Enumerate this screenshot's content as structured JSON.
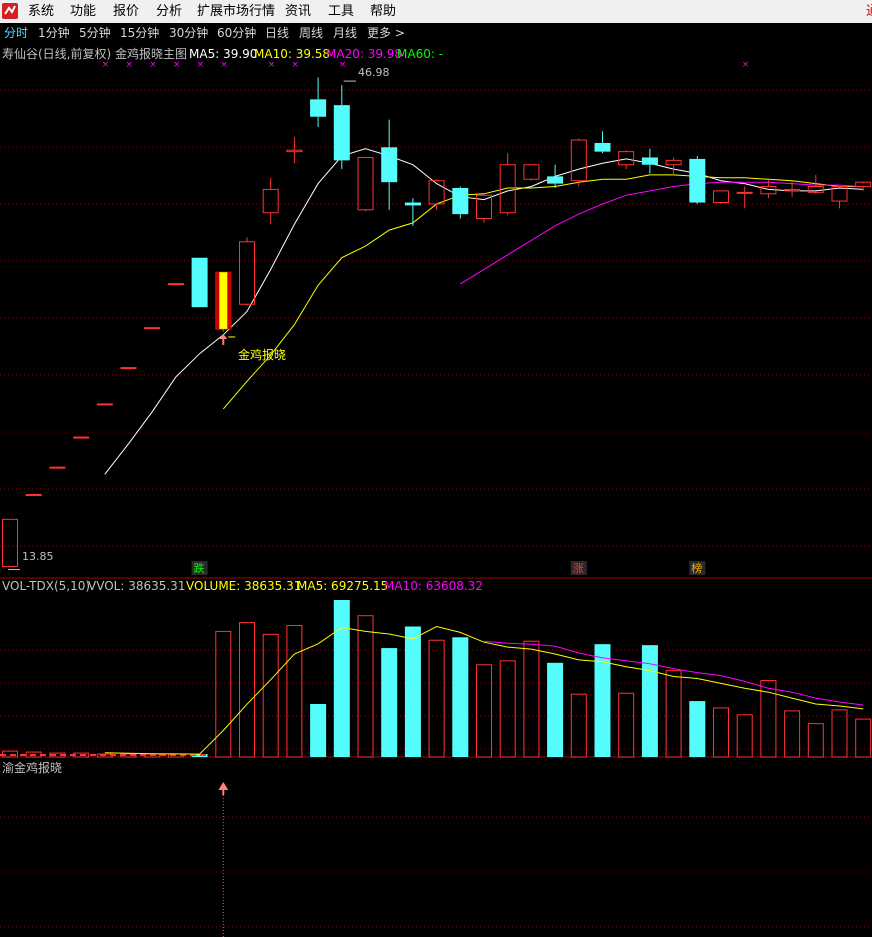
{
  "menu": [
    "系统",
    "功能",
    "报价",
    "分析",
    "扩展市场行情",
    "资讯",
    "工具",
    "帮助"
  ],
  "menu_edge": "通",
  "periods": [
    "分时",
    "1分钟",
    "5分钟",
    "15分钟",
    "30分钟",
    "60分钟",
    "日线",
    "周线",
    "月线",
    "更多 >"
  ],
  "active_period": "分时",
  "colors": {
    "up": "#ff3232",
    "down": "#54fcfc",
    "ma5": "#ffffff",
    "ma10": "#ffff00",
    "ma20": "#ff00ff",
    "ma60": "#00ff00",
    "grid": "#8b0000",
    "axis": "#a00000",
    "text": "#c0c0c0",
    "marker": "#ff8080"
  },
  "main_panel": {
    "title": "寿仙谷(日线,前复权) 金鸡报晓主图",
    "ma5_label": "MA5: 39.90",
    "ma10_label": "MA10: 39.58",
    "ma20_label": "MA20: 39.98",
    "ma60_label": "MA60: -",
    "high_label": "46.98",
    "low_label": "13.85",
    "signal_label": "金鸡报晓",
    "tags": [
      {
        "text": "跌",
        "color": "#00ff00",
        "index": 8
      },
      {
        "text": "涨",
        "color": "#ff3232",
        "index": 24
      },
      {
        "text": "榜",
        "color": "#ffb000",
        "index": 29
      }
    ]
  },
  "volume_panel": {
    "title": "VOL-TDX(5,10)",
    "vvol_label": "VVOL: 38635.31",
    "volume_label": "VOLUME: 38635.31",
    "ma5_label": "MA5: 69275.15",
    "ma10_label": "MA10: 63608.32"
  },
  "signal_panel": {
    "title": "渝金鸡报晓"
  },
  "chart_data": {
    "type": "candlestick",
    "price_axis": [
      13.2,
      48.5
    ],
    "volume_axis": [
      0,
      160000
    ],
    "signal_index": 9,
    "cross_marker_indices": [
      4,
      5,
      6,
      7,
      8,
      9,
      11,
      12,
      14,
      31
    ],
    "candles": [
      {
        "o": 13.85,
        "h": 17.1,
        "l": 13.85,
        "c": 17.1
      },
      {
        "o": 18.81,
        "h": 18.81,
        "l": 18.81,
        "c": 18.81
      },
      {
        "o": 20.69,
        "h": 20.69,
        "l": 20.69,
        "c": 20.69
      },
      {
        "o": 22.76,
        "h": 22.76,
        "l": 22.76,
        "c": 22.76
      },
      {
        "o": 25.04,
        "h": 25.04,
        "l": 25.04,
        "c": 25.04
      },
      {
        "o": 27.54,
        "h": 27.54,
        "l": 27.54,
        "c": 27.54
      },
      {
        "o": 30.29,
        "h": 30.29,
        "l": 30.29,
        "c": 30.29
      },
      {
        "o": 33.32,
        "h": 33.32,
        "l": 33.32,
        "c": 33.32
      },
      {
        "o": 35.1,
        "h": 35.1,
        "l": 31.7,
        "c": 31.7
      },
      {
        "o": 30.2,
        "h": 34.1,
        "l": 30.0,
        "c": 34.1
      },
      {
        "o": 31.9,
        "h": 36.5,
        "l": 31.8,
        "c": 36.2
      },
      {
        "o": 38.2,
        "h": 40.6,
        "l": 37.4,
        "c": 39.8
      },
      {
        "o": 42.4,
        "h": 43.4,
        "l": 41.6,
        "c": 42.5
      },
      {
        "o": 46.0,
        "h": 47.5,
        "l": 44.1,
        "c": 44.8
      },
      {
        "o": 45.6,
        "h": 46.98,
        "l": 41.2,
        "c": 41.8
      },
      {
        "o": 38.4,
        "h": 42.0,
        "l": 38.3,
        "c": 42.0
      },
      {
        "o": 42.7,
        "h": 44.6,
        "l": 38.4,
        "c": 40.3
      },
      {
        "o": 38.9,
        "h": 39.2,
        "l": 37.3,
        "c": 38.7
      },
      {
        "o": 38.8,
        "h": 40.5,
        "l": 38.4,
        "c": 40.4
      },
      {
        "o": 39.9,
        "h": 40.0,
        "l": 37.8,
        "c": 38.1
      },
      {
        "o": 37.8,
        "h": 39.5,
        "l": 37.5,
        "c": 39.4
      },
      {
        "o": 38.2,
        "h": 42.3,
        "l": 38.0,
        "c": 41.5
      },
      {
        "o": 40.5,
        "h": 41.5,
        "l": 40.4,
        "c": 41.5
      },
      {
        "o": 40.7,
        "h": 41.5,
        "l": 39.9,
        "c": 40.2
      },
      {
        "o": 40.4,
        "h": 43.3,
        "l": 40.0,
        "c": 43.2
      },
      {
        "o": 43.0,
        "h": 43.8,
        "l": 42.3,
        "c": 42.4
      },
      {
        "o": 41.5,
        "h": 42.5,
        "l": 41.2,
        "c": 42.4
      },
      {
        "o": 42.0,
        "h": 42.6,
        "l": 40.9,
        "c": 41.5
      },
      {
        "o": 41.5,
        "h": 42.0,
        "l": 40.8,
        "c": 41.8
      },
      {
        "o": 41.9,
        "h": 42.1,
        "l": 38.8,
        "c": 38.9
      },
      {
        "o": 38.9,
        "h": 39.7,
        "l": 38.8,
        "c": 39.7
      },
      {
        "o": 39.6,
        "h": 40.0,
        "l": 38.5,
        "c": 39.6
      },
      {
        "o": 39.5,
        "h": 40.5,
        "l": 39.2,
        "c": 40.0
      },
      {
        "o": 39.7,
        "h": 40.4,
        "l": 39.3,
        "c": 39.8
      },
      {
        "o": 39.6,
        "h": 40.8,
        "l": 39.5,
        "c": 40.0
      },
      {
        "o": 39.0,
        "h": 40.0,
        "l": 38.5,
        "c": 40.0
      },
      {
        "o": 40.0,
        "h": 40.2,
        "l": 39.7,
        "c": 40.3
      }
    ],
    "ma5": [
      null,
      null,
      null,
      null,
      20.2,
      22.3,
      24.5,
      26.9,
      28.5,
      29.8,
      31.4,
      34.3,
      37.4,
      40.2,
      42.1,
      42.6,
      42.1,
      41.5,
      40.2,
      39.3,
      39.1,
      39.7,
      40.0,
      40.7,
      41.2,
      41.6,
      41.9,
      41.6,
      41.2,
      40.9,
      40.4,
      40.2,
      39.8,
      39.7,
      39.7,
      39.9,
      39.8
    ],
    "ma10": [
      null,
      null,
      null,
      null,
      null,
      null,
      null,
      null,
      null,
      24.7,
      26.6,
      28.4,
      30.5,
      33.2,
      35.1,
      35.9,
      37.0,
      37.5,
      38.8,
      39.4,
      39.5,
      39.9,
      39.9,
      40.0,
      40.3,
      40.5,
      40.5,
      40.8,
      40.8,
      40.7,
      40.6,
      40.6,
      40.5,
      40.4,
      40.2,
      40.0,
      40.0
    ],
    "ma20": [
      null,
      null,
      null,
      null,
      null,
      null,
      null,
      null,
      null,
      null,
      null,
      null,
      null,
      null,
      null,
      null,
      null,
      null,
      null,
      33.3,
      34.3,
      35.3,
      36.3,
      37.3,
      38.1,
      38.8,
      39.4,
      39.7,
      40.0,
      40.2,
      40.3,
      40.3,
      40.3,
      40.2,
      40.1,
      40.1,
      39.98
    ],
    "volume": [
      6000,
      5000,
      4000,
      4000,
      3000,
      3000,
      3000,
      3000,
      3000,
      128000,
      137000,
      125000,
      134000,
      54000,
      160000,
      144000,
      111000,
      133000,
      119000,
      122000,
      94000,
      98000,
      118000,
      96000,
      64000,
      115000,
      65000,
      114000,
      88000,
      57000,
      50000,
      43000,
      78000,
      47000,
      34000,
      48000,
      38635
    ],
    "vol_ma5": [
      null,
      null,
      null,
      null,
      4400,
      3800,
      3400,
      3200,
      3000,
      27000,
      53800,
      78800,
      105000,
      115400,
      132000,
      128000,
      125400,
      120400,
      133000,
      127000,
      117000,
      112000,
      110000,
      105000,
      99000,
      97000,
      92000,
      88000,
      82000,
      80000,
      75000,
      70000,
      66000,
      60000,
      54000,
      52000,
      49000
    ],
    "vol_ma10": [
      null,
      null,
      null,
      null,
      null,
      null,
      null,
      null,
      null,
      null,
      null,
      null,
      null,
      null,
      null,
      null,
      null,
      null,
      null,
      null,
      118000,
      116000,
      115000,
      113000,
      106000,
      101000,
      98000,
      95000,
      90000,
      86000,
      83000,
      77000,
      70000,
      66000,
      60000,
      56000,
      53000
    ]
  }
}
